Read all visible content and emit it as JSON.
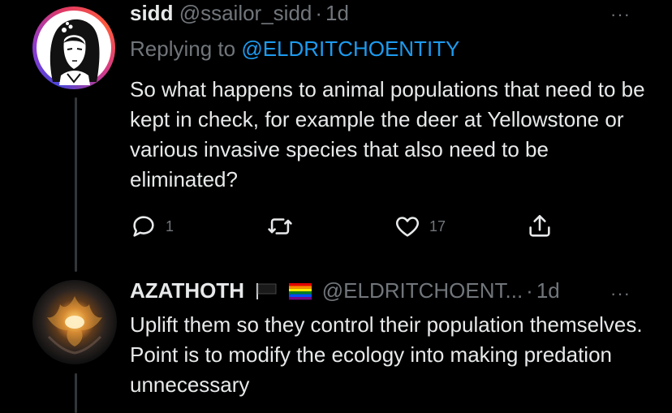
{
  "tweet1": {
    "name": "sidd",
    "handle": "@ssailor_sidd",
    "separator": "·",
    "time": "1d",
    "reply_prefix": "Replying to",
    "reply_to": "@ELDRITCHOENTITY",
    "text": "So what happens to animal populations that need to be kept in check, for example the deer at Yellowstone or various invasive species that also need to be eliminated?",
    "actions": {
      "reply_icon": "reply-icon",
      "reply_count": "1",
      "retweet_icon": "retweet-icon",
      "like_icon": "heart-icon",
      "like_count": "17",
      "share_icon": "share-icon"
    },
    "more_label": "···"
  },
  "tweet2": {
    "name": "AZATHOTH",
    "badges": [
      "black-flag-icon",
      "rainbow-flag-icon"
    ],
    "handle": "@ELDRITCHOENT...",
    "separator": "·",
    "time": "1d",
    "text": "Uplift them so they control their population themselves. Point is to modify the ecology into making predation unnecessary",
    "more_label": "···"
  },
  "colors": {
    "background": "#000000",
    "text": "#e7e9ea",
    "muted": "#71767b",
    "link": "#1d9bf0",
    "thread_line": "#333639"
  }
}
